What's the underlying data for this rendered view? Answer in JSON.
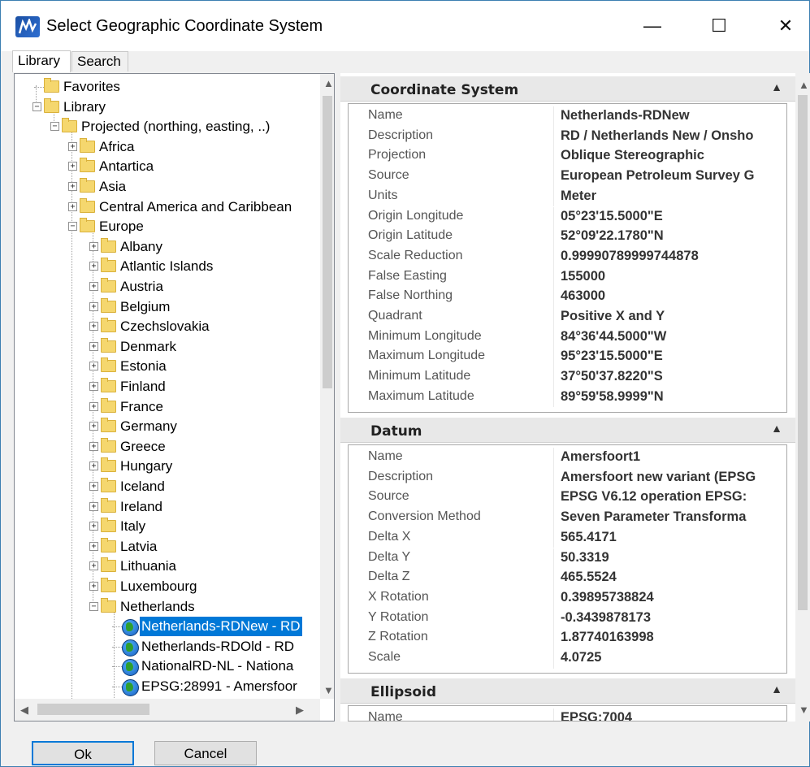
{
  "window": {
    "title": "Select Geographic Coordinate System",
    "minimize": "—",
    "maximize": "☐",
    "close": "✕"
  },
  "tabs": [
    {
      "label": "Library"
    },
    {
      "label": "Search"
    }
  ],
  "tree": {
    "rows": [
      {
        "label": "Favorites",
        "depth": 0,
        "icon": "folder",
        "expander": ""
      },
      {
        "label": "Library",
        "depth": 0,
        "icon": "folder",
        "expander": "−"
      },
      {
        "label": "Projected (northing, easting, ..)",
        "depth": 1,
        "icon": "folder",
        "expander": "−"
      },
      {
        "label": "Africa",
        "depth": 2,
        "icon": "folder",
        "expander": "+"
      },
      {
        "label": "Antartica",
        "depth": 2,
        "icon": "folder",
        "expander": "+"
      },
      {
        "label": "Asia",
        "depth": 2,
        "icon": "folder",
        "expander": "+"
      },
      {
        "label": "Central America and Caribbean",
        "depth": 2,
        "icon": "folder",
        "expander": "+"
      },
      {
        "label": "Europe",
        "depth": 2,
        "icon": "folder",
        "expander": "−"
      },
      {
        "label": "Albany",
        "depth": 3,
        "icon": "folder",
        "expander": "+"
      },
      {
        "label": "Atlantic Islands",
        "depth": 3,
        "icon": "folder",
        "expander": "+"
      },
      {
        "label": "Austria",
        "depth": 3,
        "icon": "folder",
        "expander": "+"
      },
      {
        "label": "Belgium",
        "depth": 3,
        "icon": "folder",
        "expander": "+"
      },
      {
        "label": "Czechslovakia",
        "depth": 3,
        "icon": "folder",
        "expander": "+"
      },
      {
        "label": "Denmark",
        "depth": 3,
        "icon": "folder",
        "expander": "+"
      },
      {
        "label": "Estonia",
        "depth": 3,
        "icon": "folder",
        "expander": "+"
      },
      {
        "label": "Finland",
        "depth": 3,
        "icon": "folder",
        "expander": "+"
      },
      {
        "label": "France",
        "depth": 3,
        "icon": "folder",
        "expander": "+"
      },
      {
        "label": "Germany",
        "depth": 3,
        "icon": "folder",
        "expander": "+"
      },
      {
        "label": "Greece",
        "depth": 3,
        "icon": "folder",
        "expander": "+"
      },
      {
        "label": "Hungary",
        "depth": 3,
        "icon": "folder",
        "expander": "+"
      },
      {
        "label": "Iceland",
        "depth": 3,
        "icon": "folder",
        "expander": "+"
      },
      {
        "label": "Ireland",
        "depth": 3,
        "icon": "folder",
        "expander": "+"
      },
      {
        "label": "Italy",
        "depth": 3,
        "icon": "folder",
        "expander": "+"
      },
      {
        "label": "Latvia",
        "depth": 3,
        "icon": "folder",
        "expander": "+"
      },
      {
        "label": "Lithuania",
        "depth": 3,
        "icon": "folder",
        "expander": "+"
      },
      {
        "label": "Luxembourg",
        "depth": 3,
        "icon": "folder",
        "expander": "+"
      },
      {
        "label": "Netherlands",
        "depth": 3,
        "icon": "folder",
        "expander": "−"
      },
      {
        "label": "Netherlands-RDNew - RD",
        "depth": 4,
        "icon": "globe",
        "expander": "",
        "selected": true
      },
      {
        "label": "Netherlands-RDOld - RD",
        "depth": 4,
        "icon": "globe",
        "expander": ""
      },
      {
        "label": "NationalRD-NL - Nationa",
        "depth": 4,
        "icon": "globe",
        "expander": ""
      },
      {
        "label": "EPSG:28991 - Amersfoor",
        "depth": 4,
        "icon": "globe",
        "expander": ""
      }
    ]
  },
  "sections": [
    {
      "title": "Coordinate System",
      "props": [
        {
          "k": "Name",
          "v": "Netherlands-RDNew"
        },
        {
          "k": "Description",
          "v": "RD / Netherlands New / Onsho"
        },
        {
          "k": "Projection",
          "v": "Oblique Stereographic"
        },
        {
          "k": "Source",
          "v": "European Petroleum Survey G"
        },
        {
          "k": "Units",
          "v": "Meter"
        },
        {
          "k": "Origin Longitude",
          "v": "05°23'15.5000\"E"
        },
        {
          "k": "Origin Latitude",
          "v": "52°09'22.1780\"N"
        },
        {
          "k": "Scale Reduction",
          "v": "0.99990789999744878"
        },
        {
          "k": "False Easting",
          "v": "155000"
        },
        {
          "k": "False Northing",
          "v": "463000"
        },
        {
          "k": "Quadrant",
          "v": "Positive X and Y"
        },
        {
          "k": "Minimum Longitude",
          "v": "84°36'44.5000\"W"
        },
        {
          "k": "Maximum Longitude",
          "v": "95°23'15.5000\"E"
        },
        {
          "k": "Minimum Latitude",
          "v": "37°50'37.8220\"S"
        },
        {
          "k": "Maximum Latitude",
          "v": "89°59'58.9999\"N"
        }
      ]
    },
    {
      "title": "Datum",
      "props": [
        {
          "k": "Name",
          "v": "Amersfoort1"
        },
        {
          "k": "Description",
          "v": "Amersfoort new variant (EPSG"
        },
        {
          "k": "Source",
          "v": "EPSG V6.12 operation EPSG:"
        },
        {
          "k": "Conversion Method",
          "v": "Seven Parameter Transforma"
        },
        {
          "k": "Delta X",
          "v": "565.4171"
        },
        {
          "k": "Delta Y",
          "v": "50.3319"
        },
        {
          "k": "Delta Z",
          "v": "465.5524"
        },
        {
          "k": "X Rotation",
          "v": "0.39895738824"
        },
        {
          "k": "Y Rotation",
          "v": "-0.3439878173"
        },
        {
          "k": "Z Rotation",
          "v": "1.87740163998"
        },
        {
          "k": "Scale",
          "v": "4.0725"
        }
      ]
    },
    {
      "title": "Ellipsoid",
      "props": [
        {
          "k": "Name",
          "v": "EPSG:7004"
        }
      ]
    }
  ],
  "buttons": {
    "ok": "Ok",
    "cancel": "Cancel"
  },
  "colors": {
    "selection": "#0078d7",
    "window_border": "#3c7fb1"
  }
}
